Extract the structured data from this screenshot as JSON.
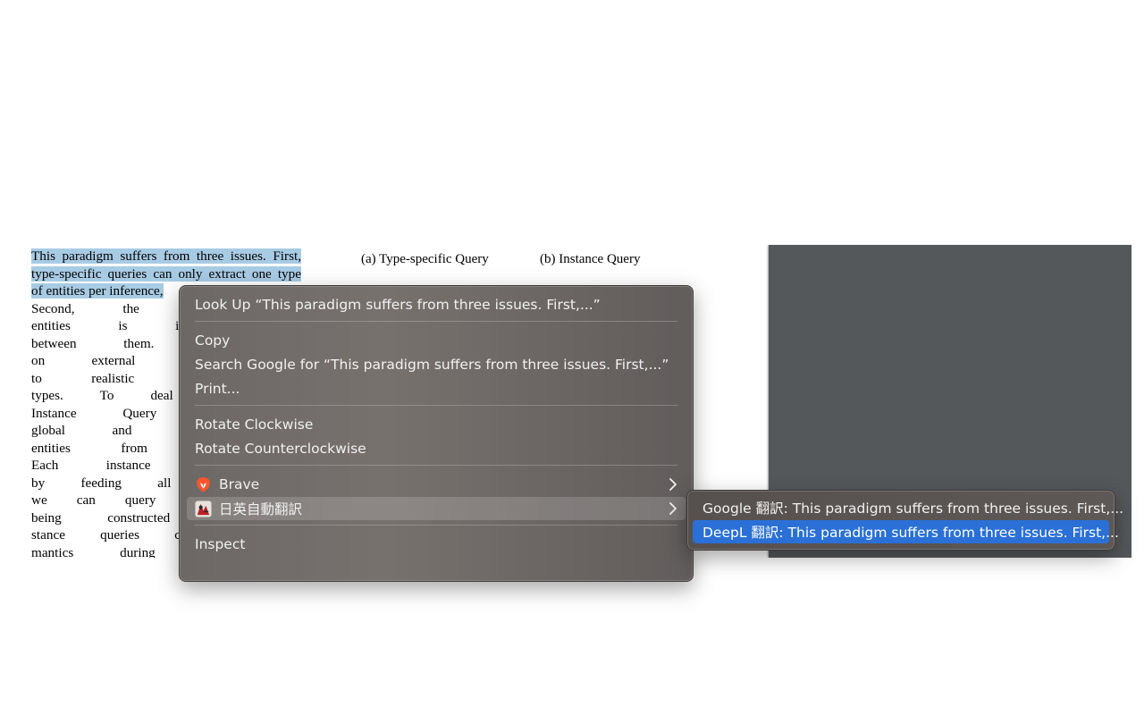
{
  "document": {
    "lines": [
      {
        "text": "This paradigm suffers from three issues. First,",
        "selected": true
      },
      {
        "text": "type-specific queries can only extract one type",
        "selected": true
      },
      {
        "text": "of entities per inference,",
        "selected": true
      },
      {
        "text": "Second, the extraction fo",
        "selected": false
      },
      {
        "text": "entities is isolated, ignori",
        "selected": false
      },
      {
        "text": "between them. Third, que",
        "selected": false
      },
      {
        "text": "on external knowledge an",
        "selected": false
      },
      {
        "text": "to realistic scenarios wit",
        "selected": false
      },
      {
        "text": "types. To deal with them,",
        "selected": false
      },
      {
        "text": "Instance Query Network (",
        "selected": false
      },
      {
        "text": "global and learnable insta",
        "selected": false
      },
      {
        "text": "entities from a sentence",
        "selected": false
      },
      {
        "text": "Each instance query pred",
        "selected": false
      },
      {
        "text": "by feeding all instance qu",
        "selected": false
      },
      {
        "text": "we can query all entities i",
        "selected": false
      },
      {
        "text": "being constructed from ex",
        "selected": false
      },
      {
        "text": "stance queries can learn th",
        "selected": false
      },
      {
        "text": "mantics during training. F",
        "selected": false
      }
    ],
    "caption_a": "(a) Type-specific Query",
    "caption_b": "(b) Instance Query"
  },
  "context_menu": {
    "look_up": "Look Up “This paradigm suffers from three issues. First,...”",
    "copy": "Copy",
    "search_google": "Search Google for “This paradigm suffers from three issues. First,...”",
    "print": "Print...",
    "rotate_cw": "Rotate Clockwise",
    "rotate_ccw": "Rotate Counterclockwise",
    "brave": "Brave",
    "brave_icon": "brave-lion-icon",
    "jp_translate": "日英自動翻訳",
    "jp_translate_icon": "translate-app-icon",
    "inspect": "Inspect"
  },
  "submenu": {
    "google": "Google 翻訳: This paradigm suffers from three issues. First,...",
    "deepl": "DeepL 翻訳: This paradigm suffers from three issues. First,..."
  },
  "colors": {
    "selection": "#a8cbe4",
    "menu_bg": "#706b69",
    "submenu_active": "#2a70d6",
    "dark_panel": "#55585b"
  }
}
